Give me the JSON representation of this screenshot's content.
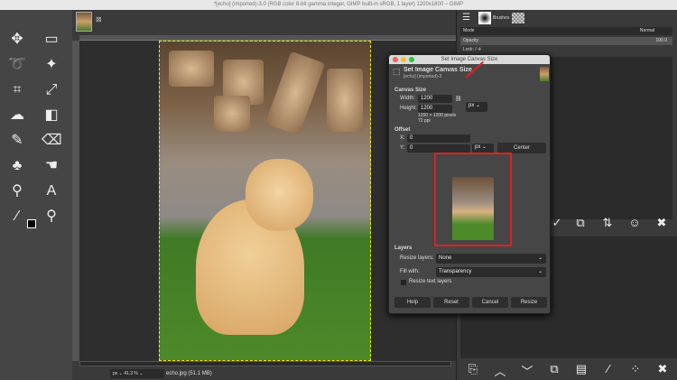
{
  "window": {
    "title": "*[echo] (imported)-3.0 (RGB color 8-bit gamma integer, GIMP built-in sRGB, 1 layer) 1200x1800 – GIMP"
  },
  "status": {
    "unit": "px",
    "zoom": "41.3 %",
    "file": "echo.jpg (51.1 MB)"
  },
  "right_panel": {
    "brushes_label": "Brushes",
    "mode_label": "Mode",
    "mode_value": "Normal",
    "opacity_label": "Opacity",
    "opacity_value": "100.0",
    "lock_label": "Lock:"
  },
  "dialog": {
    "window_title": "Set Image Canvas Size",
    "heading": "Set Image Canvas Size",
    "subheading": "[echo] (imported)-3",
    "canvas_size_label": "Canvas Size",
    "width_label": "Width:",
    "width_value": "1200",
    "height_label": "Height:",
    "height_value": "1200",
    "unit": "px",
    "size_info": "1200 × 1200 pixels",
    "ppi_info": "72 ppi",
    "offset_label": "Offset",
    "x_label": "X:",
    "x_value": "0",
    "y_label": "Y:",
    "y_value": "0",
    "offset_unit": "px",
    "center_button": "Center",
    "layers_label": "Layers",
    "resize_layers_label": "Resize layers:",
    "resize_layers_value": "None",
    "fill_with_label": "Fill with:",
    "fill_with_value": "Transparency",
    "resize_text_layers_label": "Resize text layers",
    "resize_text_layers_checked": false,
    "buttons": [
      "Help",
      "Reset",
      "Cancel",
      "Resize"
    ],
    "annotation_color": "#e02020"
  }
}
